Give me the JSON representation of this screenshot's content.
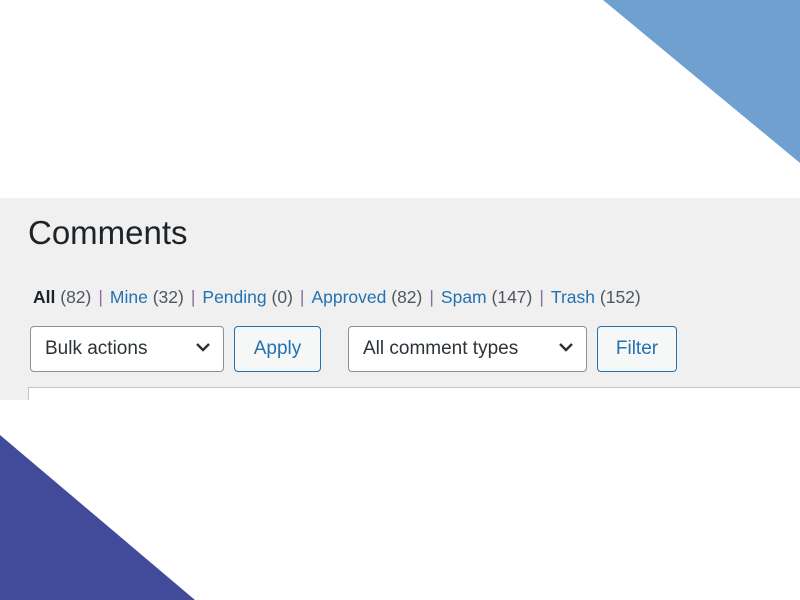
{
  "colors": {
    "top_triangle": "#6fa0cf",
    "bottom_triangle": "#424b9a",
    "link": "#2271b1",
    "panel_bg": "#f0f0f1"
  },
  "page_title": "Comments",
  "views": [
    {
      "label": "All",
      "count": "(82)",
      "current": true
    },
    {
      "label": "Mine",
      "count": "(32)"
    },
    {
      "label": "Pending",
      "count": "(0)"
    },
    {
      "label": "Approved",
      "count": "(82)"
    },
    {
      "label": "Spam",
      "count": "(147)"
    },
    {
      "label": "Trash",
      "count": "(152)"
    }
  ],
  "separator": "|",
  "toolbar": {
    "bulk_actions": {
      "selected": "Bulk actions",
      "icon": "chevron-down-icon"
    },
    "apply_label": "Apply",
    "comment_types": {
      "selected": "All comment types",
      "icon": "chevron-down-icon"
    },
    "filter_label": "Filter"
  }
}
